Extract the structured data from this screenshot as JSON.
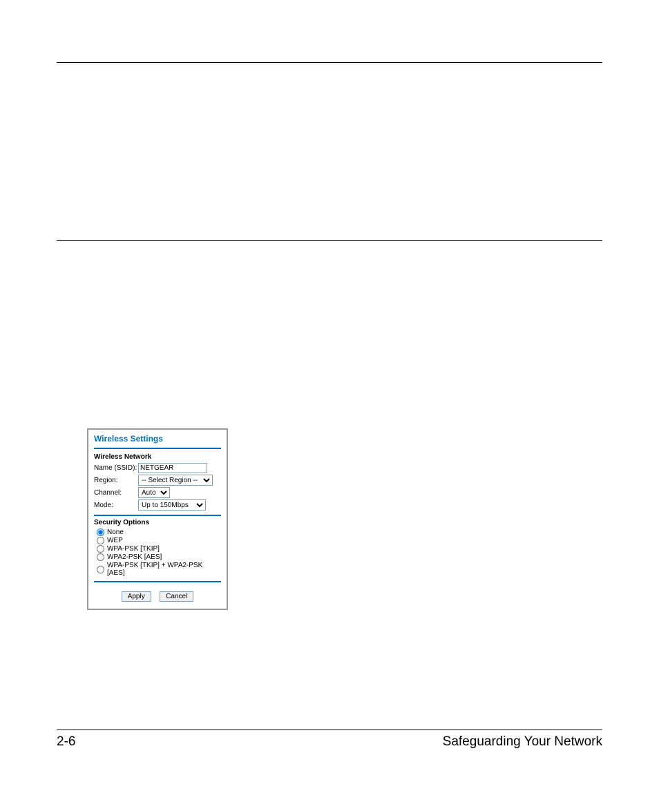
{
  "page": {
    "number": "2-6",
    "section_title": "Safeguarding Your Network"
  },
  "panel": {
    "title": "Wireless Settings",
    "network": {
      "heading": "Wireless Network",
      "ssid_label": "Name (SSID):",
      "ssid_value": "NETGEAR",
      "region_label": "Region:",
      "region_value": "-- Select Region --",
      "channel_label": "Channel:",
      "channel_value": "Auto",
      "mode_label": "Mode:",
      "mode_value": "Up to 150Mbps"
    },
    "security": {
      "heading": "Security Options",
      "options": [
        "None",
        "WEP",
        "WPA-PSK [TKIP]",
        "WPA2-PSK [AES]",
        "WPA-PSK [TKIP] + WPA2-PSK [AES]"
      ],
      "selected_index": 0
    },
    "buttons": {
      "apply": "Apply",
      "cancel": "Cancel"
    }
  }
}
